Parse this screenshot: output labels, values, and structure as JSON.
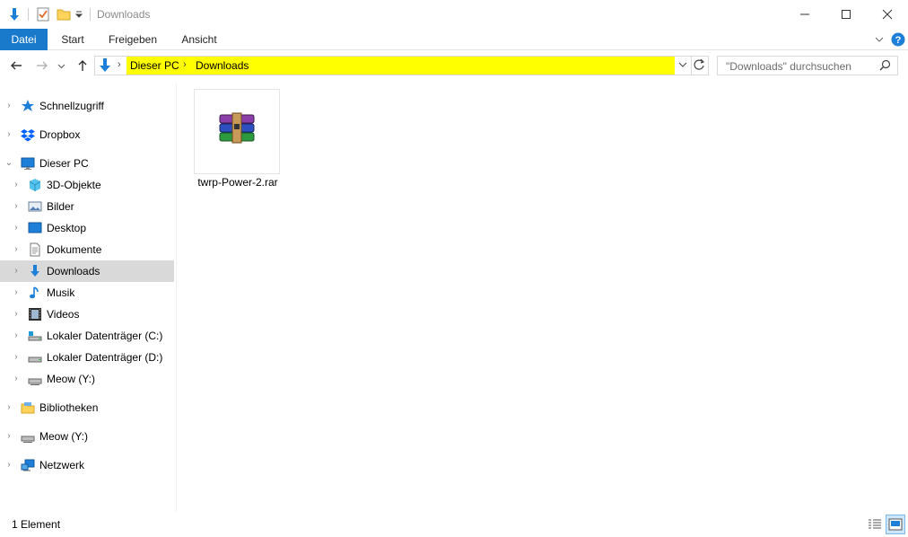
{
  "window": {
    "title": "Downloads",
    "minimize_glyph": "—",
    "maximize_glyph": "☐",
    "close_glyph": "✕"
  },
  "quick_access": {
    "icons": [
      "down-arrow-icon",
      "properties-icon",
      "new-folder-icon",
      "customize-dropdown-icon"
    ]
  },
  "ribbon": {
    "tabs": [
      {
        "label": "Datei",
        "active": true
      },
      {
        "label": "Start"
      },
      {
        "label": "Freigeben"
      },
      {
        "label": "Ansicht"
      }
    ],
    "help_glyph": "?"
  },
  "address": {
    "crumbs": [
      "Dieser PC",
      "Downloads"
    ],
    "separator": "›",
    "highlight_color": "#ffff00"
  },
  "search": {
    "placeholder": "\"Downloads\" durchsuchen"
  },
  "nav": {
    "items": [
      {
        "label": "Schnellzugriff",
        "icon": "star-icon",
        "expanded": false
      },
      {
        "label": "Dropbox",
        "icon": "dropbox-icon",
        "expanded": false
      },
      {
        "label": "Dieser PC",
        "icon": "computer-icon",
        "expanded": true
      },
      {
        "label": "3D-Objekte",
        "icon": "cube-icon",
        "expanded": false
      },
      {
        "label": "Bilder",
        "icon": "pictures-icon",
        "expanded": false
      },
      {
        "label": "Desktop",
        "icon": "desktop-icon",
        "expanded": false
      },
      {
        "label": "Dokumente",
        "icon": "documents-icon",
        "expanded": false
      },
      {
        "label": "Downloads",
        "icon": "downloads-icon",
        "expanded": false,
        "selected": true
      },
      {
        "label": "Musik",
        "icon": "music-icon",
        "expanded": false
      },
      {
        "label": "Videos",
        "icon": "videos-icon",
        "expanded": false
      },
      {
        "label": "Lokaler Datenträger (C:)",
        "icon": "system-drive-icon",
        "expanded": false
      },
      {
        "label": "Lokaler Datenträger (D:)",
        "icon": "drive-icon",
        "expanded": false
      },
      {
        "label": "Meow (Y:)",
        "icon": "network-drive-icon",
        "expanded": false
      },
      {
        "label": "Bibliotheken",
        "icon": "libraries-icon",
        "expanded": false
      },
      {
        "label": "Meow (Y:)",
        "icon": "network-drive-icon",
        "expanded": false
      },
      {
        "label": "Netzwerk",
        "icon": "network-icon",
        "expanded": false
      }
    ]
  },
  "content": {
    "files": [
      {
        "name": "twrp-Power-2.rar",
        "icon": "winrar-archive-icon"
      }
    ]
  },
  "status": {
    "item_count": "1 Element"
  },
  "colors": {
    "accent": "#1979ca",
    "selection": "#d9d9d9"
  }
}
